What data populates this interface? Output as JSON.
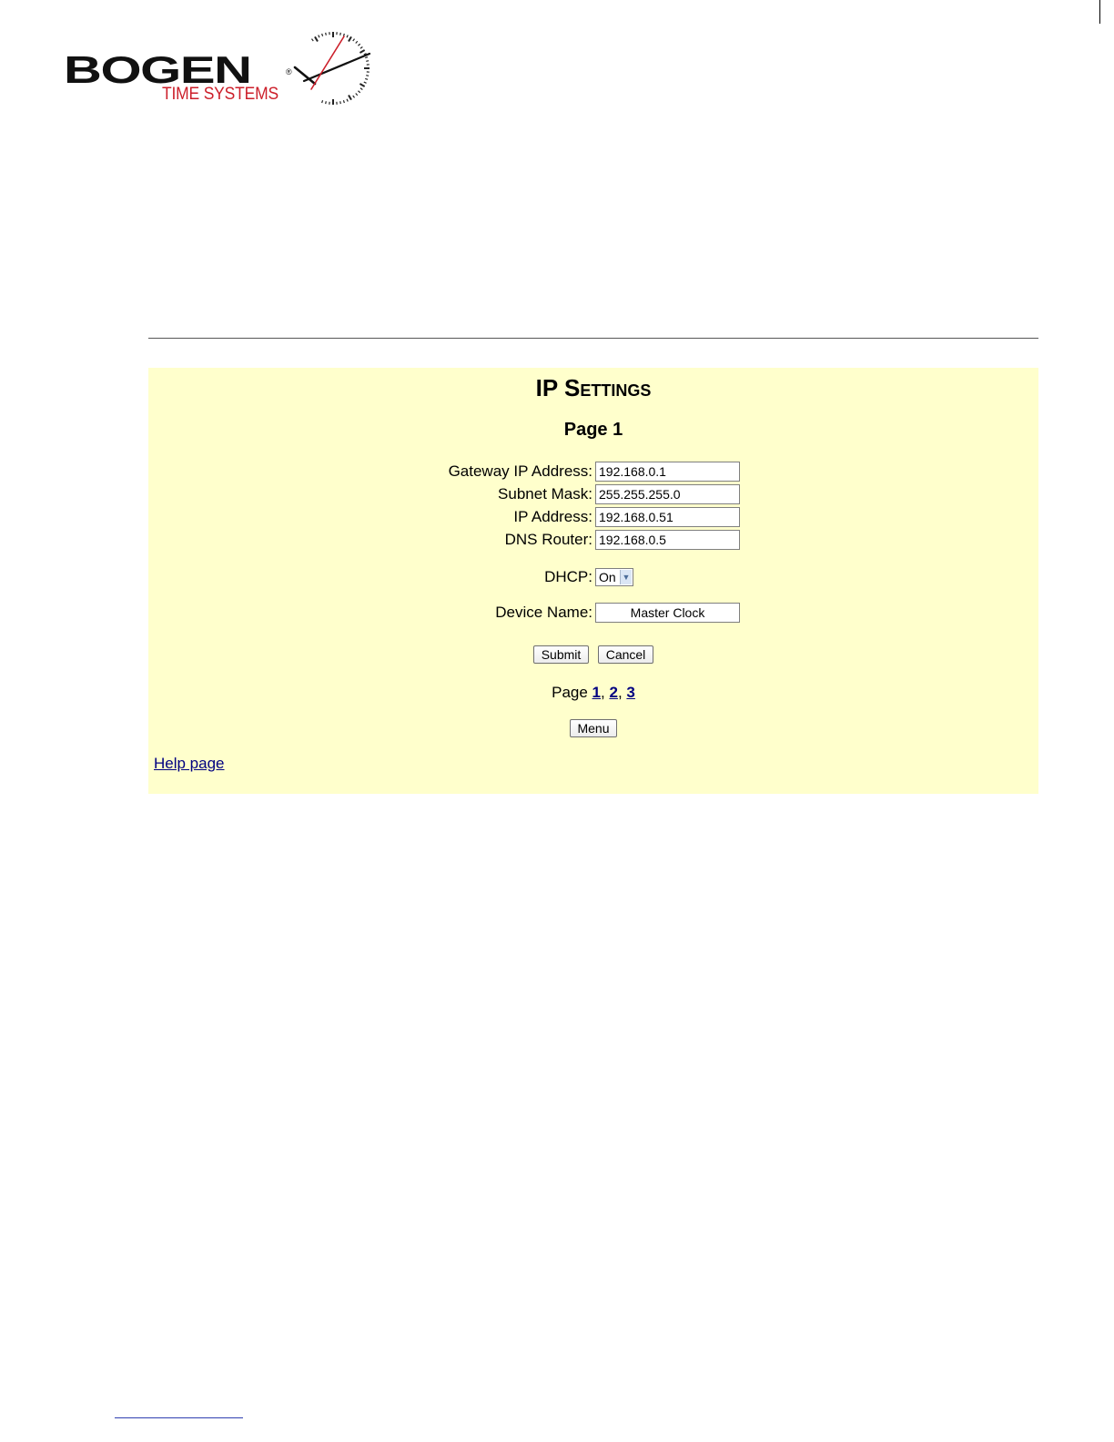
{
  "logo": {
    "brand": "BOGEN",
    "registered": "®",
    "subtitle": "TIME SYSTEMS"
  },
  "colors": {
    "panel_background": "#ffffcc",
    "logo_red": "#cc1f2a",
    "link": "#000080"
  },
  "panel": {
    "title": "IP Settings",
    "page_heading": "Page 1",
    "fields": {
      "gateway": {
        "label": "Gateway IP Address:",
        "value": "192.168.0.1"
      },
      "subnet": {
        "label": "Subnet Mask:",
        "value": "255.255.255.0"
      },
      "ip": {
        "label": "IP Address:",
        "value": "192.168.0.51"
      },
      "dns": {
        "label": "DNS Router:",
        "value": "192.168.0.5"
      }
    },
    "dhcp": {
      "label": "DHCP:",
      "selected": "On",
      "arrow_icon": "chevron-down-icon"
    },
    "device_name": {
      "label": "Device Name:",
      "value": "Master Clock"
    },
    "buttons": {
      "submit": "Submit",
      "cancel": "Cancel",
      "menu": "Menu"
    },
    "pager": {
      "prefix": "Page",
      "pages": [
        "1",
        "2",
        "3"
      ],
      "separator": ","
    },
    "help_link": "Help page"
  }
}
